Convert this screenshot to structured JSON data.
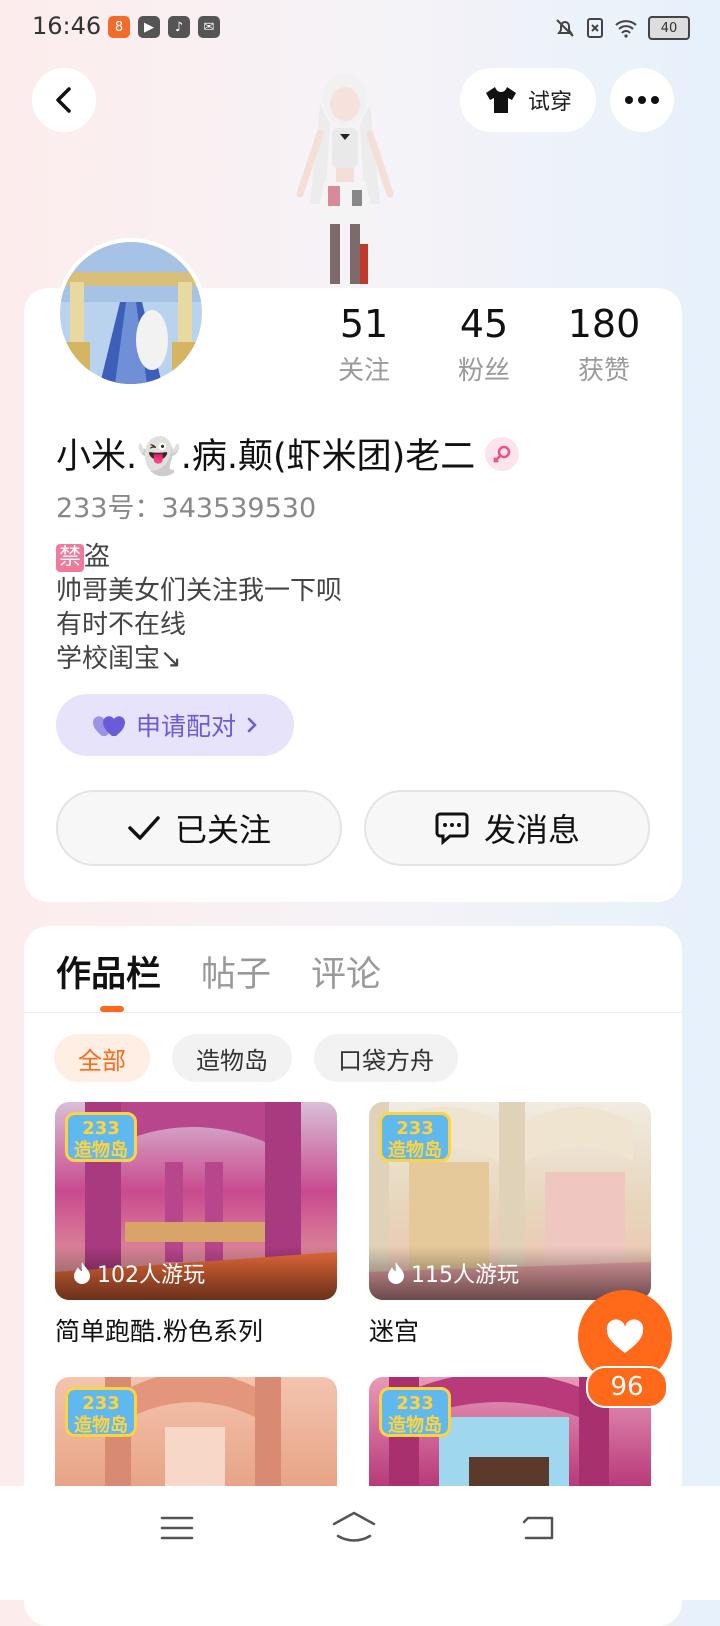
{
  "status_bar": {
    "time": "16:46",
    "battery": "40"
  },
  "header": {
    "tryon_label": "试穿"
  },
  "profile": {
    "stats": [
      {
        "value": "51",
        "label": "关注"
      },
      {
        "value": "45",
        "label": "粉丝"
      },
      {
        "value": "180",
        "label": "获赞"
      }
    ],
    "name": "小米.👻.病.颠(虾米团)老二",
    "uid": "233号：343539530",
    "bio_ban_badge": "禁",
    "bio_lines": [
      "盗",
      "帅哥美女们关注我一下呗",
      "有时不在线",
      "学校闺宝↘"
    ],
    "pair_label": "申请配对",
    "follow_label": "已关注",
    "message_label": "发消息"
  },
  "works": {
    "tabs": [
      "作品栏",
      "帖子",
      "评论"
    ],
    "active_tab": 0,
    "chips": [
      "全部",
      "造物岛",
      "口袋方舟"
    ],
    "active_chip": 0,
    "logo_text": [
      "233",
      "造物岛"
    ],
    "items": [
      {
        "plays": "102人游玩",
        "title": "简单跑酷.粉色系列",
        "theme": "#c94a8f"
      },
      {
        "plays": "115人游玩",
        "title": "迷宫",
        "theme": "#e7d7bd"
      },
      {
        "plays": "",
        "title": "",
        "theme": "#e8a487"
      },
      {
        "plays": "",
        "title": "",
        "theme": "#b83a7a"
      }
    ]
  },
  "like": {
    "count": "96"
  },
  "colors": {
    "accent": "#ff6a1a",
    "pair_purple": "#6a5cd8"
  }
}
